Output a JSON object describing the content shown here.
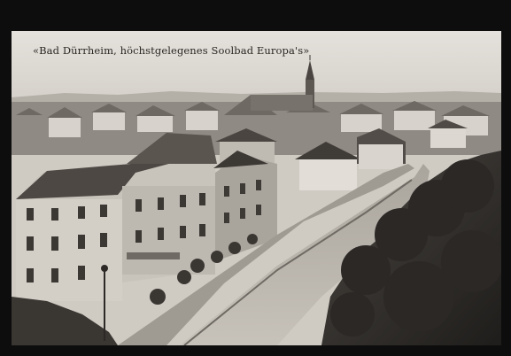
{
  "postcard": {
    "caption": "«Bad Dürrheim, höchstgelegenes Soolbad Europa's»"
  }
}
